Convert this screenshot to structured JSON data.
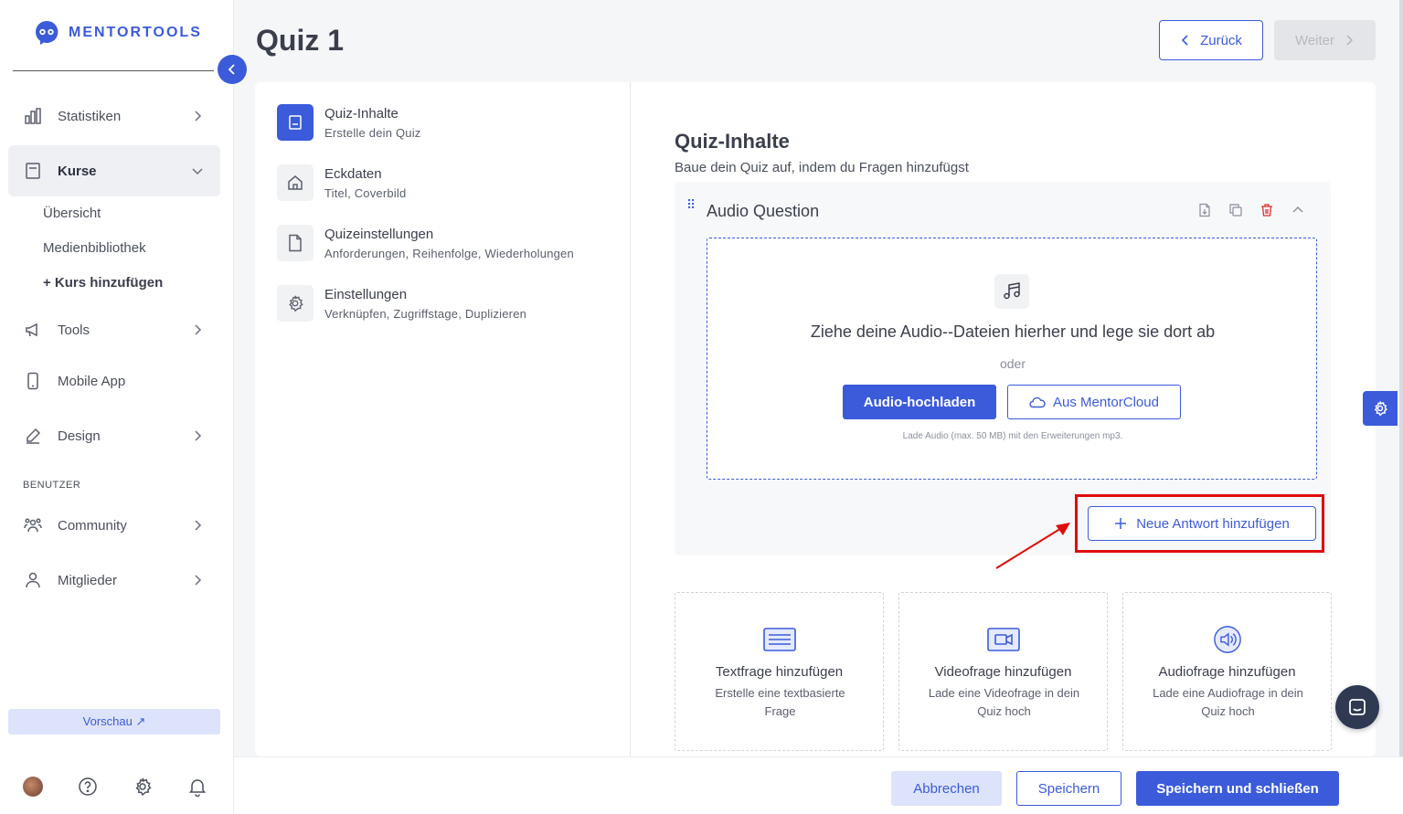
{
  "app": {
    "brand": "MENTORTOOLS"
  },
  "sidebar": {
    "items": [
      {
        "label": "Statistiken"
      },
      {
        "label": "Kurse"
      },
      {
        "label": "Tools"
      },
      {
        "label": "Mobile App"
      },
      {
        "label": "Design"
      },
      {
        "label": "Community"
      },
      {
        "label": "Mitglieder"
      }
    ],
    "subitems": [
      {
        "label": "Übersicht"
      },
      {
        "label": "Medienbibliothek"
      },
      {
        "label": "+ Kurs hinzufügen"
      }
    ],
    "section_label": "BENUTZER",
    "preview_label": "Vorschau ↗"
  },
  "header": {
    "title": "Quiz 1",
    "back_label": "Zurück",
    "next_label": "Weiter"
  },
  "steps": [
    {
      "title": "Quiz-Inhalte",
      "subtitle": "Erstelle dein Quiz"
    },
    {
      "title": "Eckdaten",
      "subtitle": "Titel, Coverbild"
    },
    {
      "title": "Quizeinstellungen",
      "subtitle": "Anforderungen, Reihenfolge, Wiederholungen"
    },
    {
      "title": "Einstellungen",
      "subtitle": "Verknüpfen, Zugriffstage, Duplizieren"
    }
  ],
  "content": {
    "title": "Quiz-Inhalte",
    "subtitle": "Baue dein Quiz auf, indem du Fragen hinzufügst"
  },
  "question": {
    "title": "Audio Question",
    "dropzone_title": "Ziehe deine Audio--Dateien hierher und lege sie dort ab",
    "dropzone_or": "oder",
    "upload_label": "Audio-hochladen",
    "cloud_label": "Aus MentorCloud",
    "hint": "Lade Audio (max. 50 MB) mit den Erweiterungen mp3.",
    "add_answer_label": "Neue Antwort hinzufügen"
  },
  "add_cards": [
    {
      "title": "Textfrage hinzufügen",
      "subtitle": "Erstelle eine textbasierte Frage"
    },
    {
      "title": "Videofrage hinzufügen",
      "subtitle": "Lade eine Videofrage in dein Quiz hoch"
    },
    {
      "title": "Audiofrage hinzufügen",
      "subtitle": "Lade eine Audiofrage in dein Quiz hoch"
    }
  ],
  "footer": {
    "cancel_label": "Abbrechen",
    "save_label": "Speichern",
    "save_close_label": "Speichern und schließen"
  },
  "colors": {
    "accent": "#3b5bdb",
    "annotation": "#e00d0d"
  },
  "icons": {
    "logo": "robot-face-icon",
    "stats": "bar-chart-icon",
    "courses": "book-icon",
    "tools": "megaphone-icon",
    "mobile": "phone-icon",
    "design": "pencil-icon",
    "community": "users-icon",
    "members": "user-icon"
  }
}
